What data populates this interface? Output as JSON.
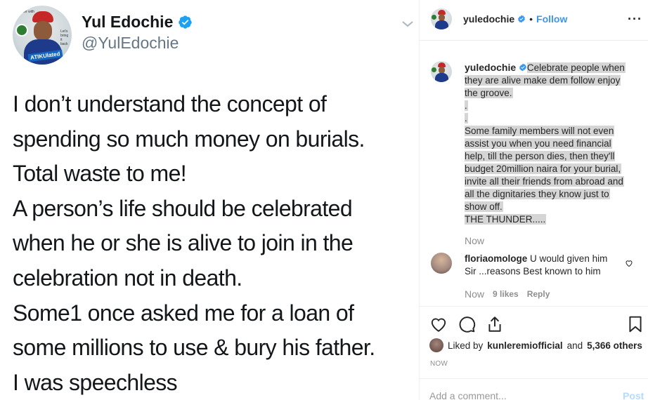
{
  "tweet": {
    "avatar_top_text": "better with",
    "avatar_side_text": "Let's bring it back",
    "avatar_tag": "ATIKUlated",
    "name": "Yul Edochie",
    "handle": "@YulEdochie",
    "lines": [
      "I don’t understand the concept of",
      "spending so much money on burials.",
      "Total waste to me!",
      "A person’s life should be celebrated",
      "when he or she is alive to join in the",
      "celebration not in death.",
      "Some1 once asked me for a loan of",
      "some millions to use & bury his father.",
      "I was speechless"
    ]
  },
  "instagram": {
    "header": {
      "username": "yuledochie",
      "dot": "•",
      "follow_label": "Follow",
      "more_label": "···"
    },
    "caption": {
      "username": "yuledochie",
      "first_line": "Celebrate people when",
      "lines": [
        "they are alive make dem follow enjoy",
        "the groove.",
        ".",
        ".",
        "Some family members will not even",
        "assist you when you need financial",
        "help, till the person dies, then they'll",
        "budget 20million naira for your burial,",
        "invite all their friends from abroad and",
        "all the dignitaries they know just to",
        "show off.",
        "THE THUNDER....."
      ],
      "time": "Now"
    },
    "comment": {
      "username": "floriaomologe",
      "text": "U would given him Sir ...reasons Best known to him",
      "time": "Now",
      "likes": "9 likes",
      "reply_label": "Reply"
    },
    "likes": {
      "prefix": "Liked by",
      "user": "kunleremiofficial",
      "middle": "and",
      "others": "5,366 others"
    },
    "post_time": "NOW",
    "add_comment_placeholder": "Add a comment...",
    "post_label": "Post"
  },
  "icons": [
    "verified-icon",
    "chevron-down-icon",
    "heart-icon",
    "comment-icon",
    "share-icon",
    "bookmark-icon"
  ],
  "colors": {
    "ig_blue": "#3897f0",
    "twitter_verified": "#1da1f2",
    "highlight": "#d5d5d5",
    "muted": "#8e8e8e"
  }
}
